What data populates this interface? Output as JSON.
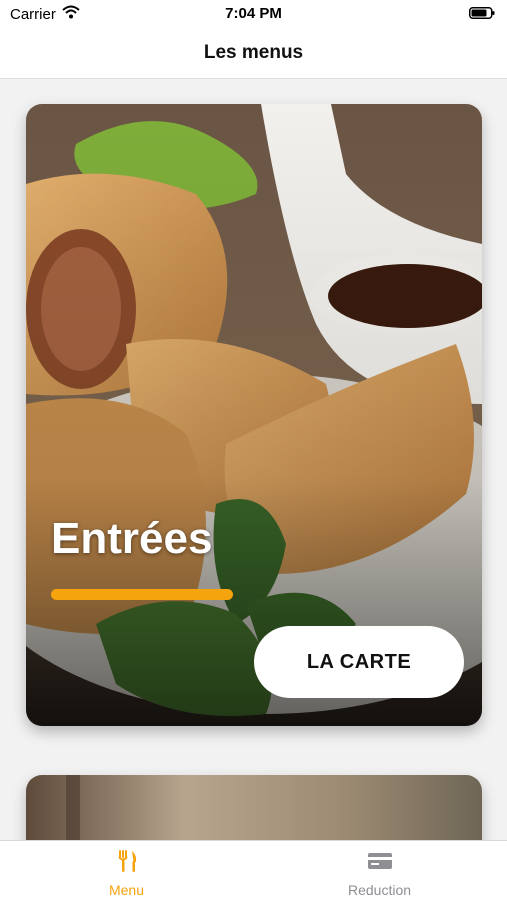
{
  "status_bar": {
    "carrier": "Carrier",
    "time": "7:04 PM"
  },
  "nav": {
    "title": "Les menus"
  },
  "cards": [
    {
      "title": "Entrées",
      "button_label": "LA CARTE",
      "image": "spring-rolls-photo"
    },
    {
      "title": "",
      "button_label": "",
      "image": "food-photo"
    }
  ],
  "tabs": [
    {
      "label": "Menu",
      "icon": "fork-knife-icon",
      "active": true
    },
    {
      "label": "Reduction",
      "icon": "credit-card-icon",
      "active": false
    }
  ],
  "colors": {
    "accent": "#f5a40e",
    "inactive": "#8e8e93"
  }
}
